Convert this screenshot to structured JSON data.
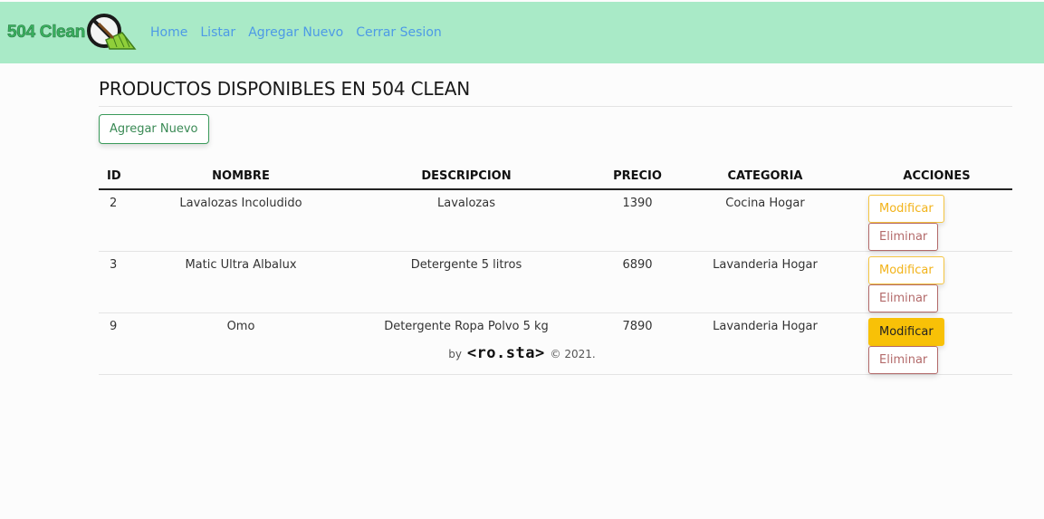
{
  "brand": {
    "name": "504 Clean"
  },
  "nav": [
    {
      "label": "Home"
    },
    {
      "label": "Listar"
    },
    {
      "label": "Agregar Nuevo"
    },
    {
      "label": "Cerrar Sesion"
    }
  ],
  "page": {
    "title": "PRODUCTOS DISPONIBLES EN 504 CLEAN",
    "add_button": "Agregar Nuevo"
  },
  "table": {
    "headers": [
      "ID",
      "NOMBRE",
      "DESCRIPCION",
      "PRECIO",
      "CATEGORIA",
      "ACCIONES"
    ],
    "rows": [
      {
        "id": "2",
        "nombre": "Lavalozas Incoludido",
        "descripcion": "Lavalozas",
        "precio": "1390",
        "categoria": "Cocina Hogar",
        "modify": "Modificar",
        "delete": "Eliminar"
      },
      {
        "id": "3",
        "nombre": "Matic Ultra Albalux",
        "descripcion": "Detergente 5 litros",
        "precio": "6890",
        "categoria": "Lavanderia Hogar",
        "modify": "Modificar",
        "delete": "Eliminar"
      },
      {
        "id": "9",
        "nombre": "Omo",
        "descripcion": "Detergente Ropa Polvo 5 kg",
        "precio": "7890",
        "categoria": "Lavanderia Hogar",
        "modify": "Modificar",
        "delete": "Eliminar"
      }
    ]
  },
  "footer": {
    "by": "by",
    "signature": "<ro.sta>",
    "copyright": "© 2021."
  },
  "colors": {
    "navbar": "#a9eac7",
    "link": "#4d9ae6",
    "warning": "#f8c107",
    "danger_outline": "#b36a6a",
    "success_outline": "#3a9a5a"
  },
  "icons": {
    "logo": "broom-no-dirt-icon"
  }
}
